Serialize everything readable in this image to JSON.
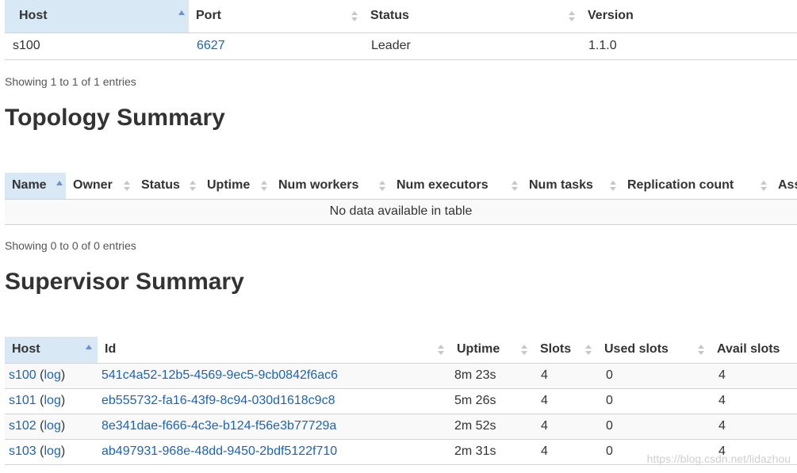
{
  "nimbus": {
    "headers": [
      "Host",
      "Port",
      "Status",
      "Version"
    ],
    "rows": [
      {
        "host": "s100",
        "port": "6627",
        "status": "Leader",
        "version": "1.1.0"
      }
    ],
    "info": "Showing 1 to 1 of 1 entries"
  },
  "topology": {
    "title": "Topology Summary",
    "headers": [
      "Name",
      "Owner",
      "Status",
      "Uptime",
      "Num workers",
      "Num executors",
      "Num tasks",
      "Replication count",
      "Ass"
    ],
    "empty": "No data available in table",
    "info": "Showing 0 to 0 of 0 entries"
  },
  "supervisor": {
    "title": "Supervisor Summary",
    "headers": [
      "Host",
      "Id",
      "Uptime",
      "Slots",
      "Used slots",
      "Avail slots"
    ],
    "rows": [
      {
        "host": "s100",
        "log": "log",
        "id": "541c4a52-12b5-4569-9ec5-9cb0842f6ac6",
        "uptime": "8m 23s",
        "slots": "4",
        "used": "0",
        "avail": "4"
      },
      {
        "host": "s101",
        "log": "log",
        "id": "eb555732-fa16-43f9-8c94-030d1618c9c8",
        "uptime": "5m 26s",
        "slots": "4",
        "used": "0",
        "avail": "4"
      },
      {
        "host": "s102",
        "log": "log",
        "id": "8e341dae-f666-4c3e-b124-f56e3b77729a",
        "uptime": "2m 52s",
        "slots": "4",
        "used": "0",
        "avail": "4"
      },
      {
        "host": "s103",
        "log": "log",
        "id": "ab497931-968e-48dd-9450-2bdf5122f710",
        "uptime": "2m 31s",
        "slots": "4",
        "used": "0",
        "avail": "4"
      }
    ]
  },
  "watermark": "https://blog.csdn.net/lidazhou"
}
